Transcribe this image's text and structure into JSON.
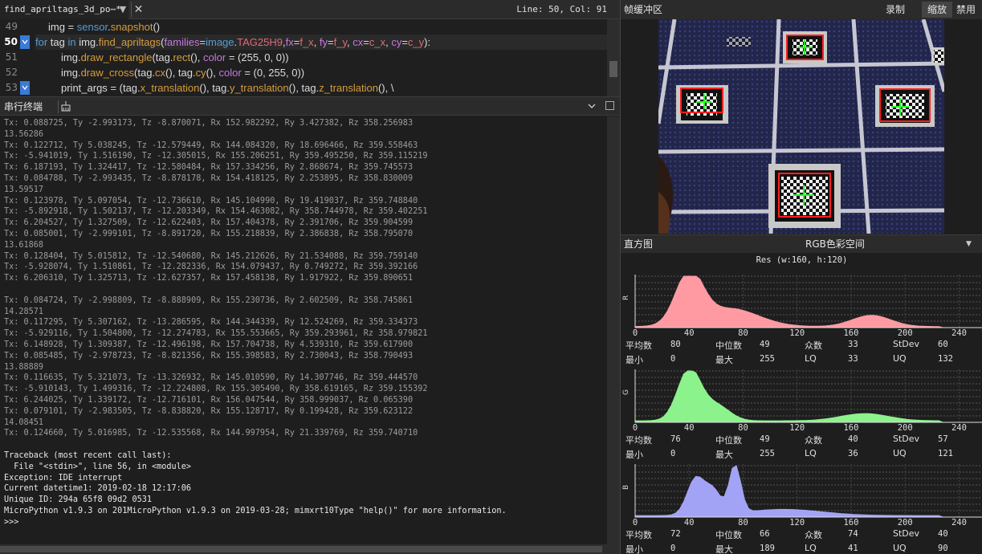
{
  "editor": {
    "tab_title": "find_apriltags_3d_po⋯*",
    "tab_menu": "▼",
    "tab_close": "✕",
    "cursor_pos": "Line: 50, Col: 91",
    "lines": [
      {
        "num": "49",
        "text": "img = sensor.snapshot()"
      },
      {
        "num": "50",
        "text": "for tag in img.find_apriltags(families=image.TAG25H9,fx=f_x, fy=f_y, cx=c_x, cy=c_y):"
      },
      {
        "num": "51",
        "text": "img.draw_rectangle(tag.rect(), color = (255, 0, 0))"
      },
      {
        "num": "52",
        "text": "img.draw_cross(tag.cx(), tag.cy(), color = (0, 255, 0))"
      },
      {
        "num": "53",
        "text": "print_args = (tag.x_translation(), tag.y_translation(), tag.z_translation(), \\"
      }
    ]
  },
  "terminal": {
    "title": "串行终端",
    "tool_icon": "clear-terminal-icon",
    "lines": [
      "Tx: 0.088725, Ty -2.993173, Tz -8.870071, Rx 152.982292, Ry 3.427382, Rz 358.256983",
      "13.56286",
      "Tx: 0.122712, Ty 5.038245, Tz -12.579449, Rx 144.084320, Ry 18.696466, Rz 359.558463",
      "Tx: -5.941019, Ty 1.516190, Tz -12.305015, Rx 155.206251, Ry 359.495250, Rz 359.115219",
      "Tx: 6.187193, Ty 1.324417, Tz -12.580484, Rx 157.334256, Ry 2.868674, Rz 359.745573",
      "Tx: 0.084788, Ty -2.993435, Tz -8.878178, Rx 154.418125, Ry 2.253895, Rz 358.830009",
      "13.59517",
      "Tx: 0.123978, Ty 5.097054, Tz -12.736610, Rx 145.104990, Ry 19.419037, Rz 359.748840",
      "Tx: -5.892918, Ty 1.502137, Tz -12.203349, Rx 154.463082, Ry 358.744978, Rz 359.402251",
      "Tx: 6.204527, Ty 1.327509, Tz -12.622403, Rx 157.404378, Ry 2.391706, Rz 359.904599",
      "Tx: 0.085001, Ty -2.999101, Tz -8.891720, Rx 155.218839, Ry 2.386838, Rz 358.795070",
      "13.61868",
      "Tx: 0.128404, Ty 5.015812, Tz -12.540680, Rx 145.212626, Ry 21.534088, Rz 359.759140",
      "Tx: -5.928074, Ty 1.510861, Tz -12.282336, Rx 154.079437, Ry 0.749272, Rz 359.392166",
      "Tx: 6.206310, Ty 1.325713, Tz -12.627357, Rx 157.458138, Ry 1.917922, Rz 359.890651",
      "",
      "Tx: 0.084724, Ty -2.998809, Tz -8.888909, Rx 155.230736, Ry 2.602509, Rz 358.745861",
      "14.28571",
      "Tx: 0.117295, Ty 5.307162, Tz -13.286595, Rx 144.344339, Ry 12.524269, Rz 359.334373",
      "Tx: -5.929116, Ty 1.504800, Tz -12.274783, Rx 155.553665, Ry 359.293961, Rz 358.979821",
      "Tx: 6.148928, Ty 1.309387, Tz -12.496198, Rx 157.704738, Ry 4.539310, Rz 359.617900",
      "Tx: 0.085485, Ty -2.978723, Tz -8.821356, Rx 155.398583, Ry 2.730043, Rz 358.790493",
      "13.88889",
      "Tx: 0.116635, Ty 5.321073, Tz -13.326932, Rx 145.010590, Ry 14.307746, Rz 359.444570",
      "Tx: -5.910143, Ty 1.499316, Tz -12.224808, Rx 155.305490, Ry 358.619165, Rz 359.155392",
      "Tx: 6.244025, Ty 1.339172, Tz -12.716101, Rx 156.047544, Ry 358.999037, Rz 0.065390",
      "Tx: 0.079101, Ty -2.983505, Tz -8.838820, Rx 155.128717, Ry 0.199428, Rz 359.623122",
      "14.08451",
      "Tx: 0.124660, Ty 5.016985, Tz -12.535568, Rx 144.997954, Ry 21.339769, Rz 359.740710",
      "",
      "Traceback (most recent call last):",
      "  File \"<stdin>\", line 56, in <module>",
      "Exception: IDE interrupt",
      "Current datetime1: 2019-02-18 12:17:06",
      "Unique ID: 294a 65f8 09d2 0531",
      "MicroPython v1.9.3 on 201MicroPython v1.9.3 on 2019-03-28; mimxrt10Type \"help()\" for more information.",
      ">>>"
    ]
  },
  "framebuffer": {
    "title": "帧缓冲区",
    "record_label": "录制",
    "zoom_label": "缩放",
    "disable_label": "禁用"
  },
  "histogram": {
    "title": "直方图",
    "colorspace": "RGB色彩空间",
    "dropdown_icon": "▼",
    "resolution": "Res (w:160, h:120)",
    "x_ticks": [
      "0",
      "40",
      "80",
      "120",
      "160",
      "200",
      "240"
    ],
    "stat_labels": {
      "mean": "平均数",
      "median": "中位数",
      "mode": "众数",
      "stdev": "StDev",
      "min": "最小",
      "max": "最大",
      "lq": "LQ",
      "uq": "UQ"
    },
    "channels": [
      {
        "name": "R",
        "color": "#ff9aa2",
        "peak_bin": 40,
        "values": {
          "mean": "80",
          "median": "49",
          "mode": "33",
          "stdev": "60",
          "min": "0",
          "max": "255",
          "lq": "33",
          "uq": "132"
        }
      },
      {
        "name": "G",
        "color": "#8cf28c",
        "peak_bin": 40,
        "values": {
          "mean": "76",
          "median": "49",
          "mode": "40",
          "stdev": "57",
          "min": "0",
          "max": "255",
          "lq": "36",
          "uq": "121"
        }
      },
      {
        "name": "B",
        "color": "#a3a3f5",
        "peak_bin": 74,
        "values": {
          "mean": "72",
          "median": "66",
          "mode": "74",
          "stdev": "40",
          "min": "0",
          "max": "189",
          "lq": "41",
          "uq": "90"
        }
      }
    ]
  }
}
